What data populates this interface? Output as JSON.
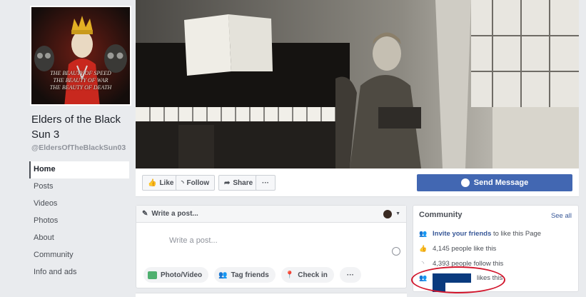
{
  "page": {
    "name": "Elders of the Black Sun 3",
    "handle": "@EldersOfTheBlackSun03",
    "avatar_motto": [
      "THE BEAUTY OF SPEED",
      "THE BEAUTY OF WAR",
      "THE BEAUTY OF DEATH"
    ]
  },
  "nav": {
    "items": [
      {
        "label": "Home"
      },
      {
        "label": "Posts"
      },
      {
        "label": "Videos"
      },
      {
        "label": "Photos"
      },
      {
        "label": "About"
      },
      {
        "label": "Community"
      },
      {
        "label": "Info and ads"
      }
    ]
  },
  "actions": {
    "like": "Like",
    "follow": "Follow",
    "share": "Share",
    "more": "···",
    "send_message": "Send Message"
  },
  "composer": {
    "header": "Write a post...",
    "placeholder": "Write a post...",
    "options": {
      "photo_video": "Photo/Video",
      "tag_friends": "Tag friends",
      "check_in": "Check in",
      "more": "···"
    }
  },
  "community": {
    "title": "Community",
    "see_all": "See all",
    "invite_link": "Invite your friends",
    "invite_rest": "to like this Page",
    "likes": "4,145 people like this",
    "follows": "4,393 people follow this",
    "friend_likes": "likes this"
  },
  "colors": {
    "brand_blue": "#4267b2",
    "link_blue": "#385898",
    "highlight_red": "#d2162c",
    "redaction": "#0a3a7e"
  }
}
